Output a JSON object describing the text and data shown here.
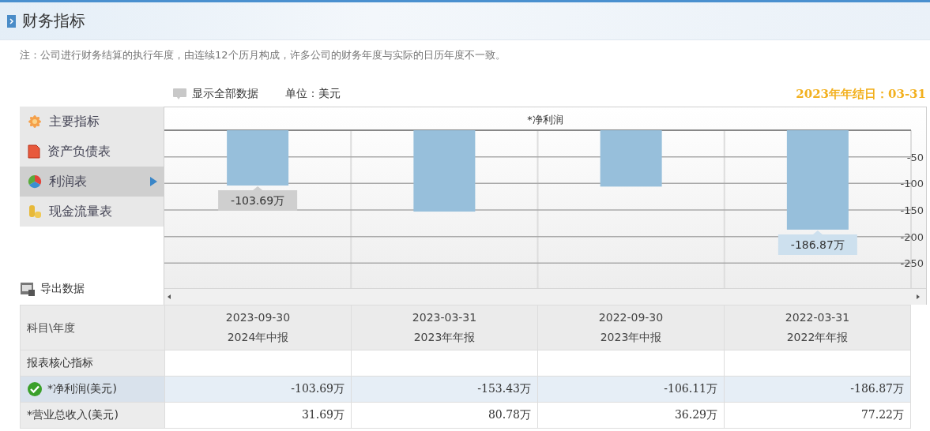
{
  "header": {
    "title": "财务指标"
  },
  "note": "注：公司进行财务结算的执行年度，由连续12个历月构成，许多公司的财务年度与实际的日历年度不一致。",
  "toolbar": {
    "show_all": "显示全部数据",
    "unit": "单位：美元",
    "fiscal_year_end": "2023年年结日：03-31"
  },
  "sidebar": {
    "items": [
      {
        "label": "主要指标",
        "kind": "flower",
        "selected": false
      },
      {
        "label": "资产负债表",
        "kind": "document",
        "selected": false
      },
      {
        "label": "利润表",
        "kind": "pie",
        "selected": true
      },
      {
        "label": "现金流量表",
        "kind": "coins",
        "selected": false
      }
    ],
    "export": "导出数据"
  },
  "chart": {
    "chart_data": {
      "type": "bar",
      "title": "*净利润",
      "values": [
        -104,
        -153,
        -106,
        -187
      ],
      "ylim": [
        -297,
        0
      ],
      "yticks": [
        -50,
        -100,
        -150,
        -200,
        -250
      ],
      "grid": true,
      "annotations": [
        "-103.69万",
        "-186.87万"
      ]
    }
  },
  "table": {
    "corner": "科目\\年度",
    "columns": [
      {
        "date": "2023-09-30",
        "report": "2024年中报"
      },
      {
        "date": "2023-03-31",
        "report": "2023年年报"
      },
      {
        "date": "2022-09-30",
        "report": "2023年中报"
      },
      {
        "date": "2022-03-31",
        "report": "2022年年报"
      }
    ],
    "rows": [
      {
        "label": "报表核心指标",
        "kind": "section",
        "selected": false
      },
      {
        "label": "*净利润(美元)",
        "kind": "metric",
        "selected": true,
        "cells": [
          "-103.69万",
          "-153.43万",
          "-106.11万",
          "-186.87万"
        ]
      },
      {
        "label": "*营业总收入(美元)",
        "kind": "metric",
        "selected": false,
        "cells": [
          "31.69万",
          "80.78万",
          "36.29万",
          "77.22万"
        ]
      }
    ]
  }
}
